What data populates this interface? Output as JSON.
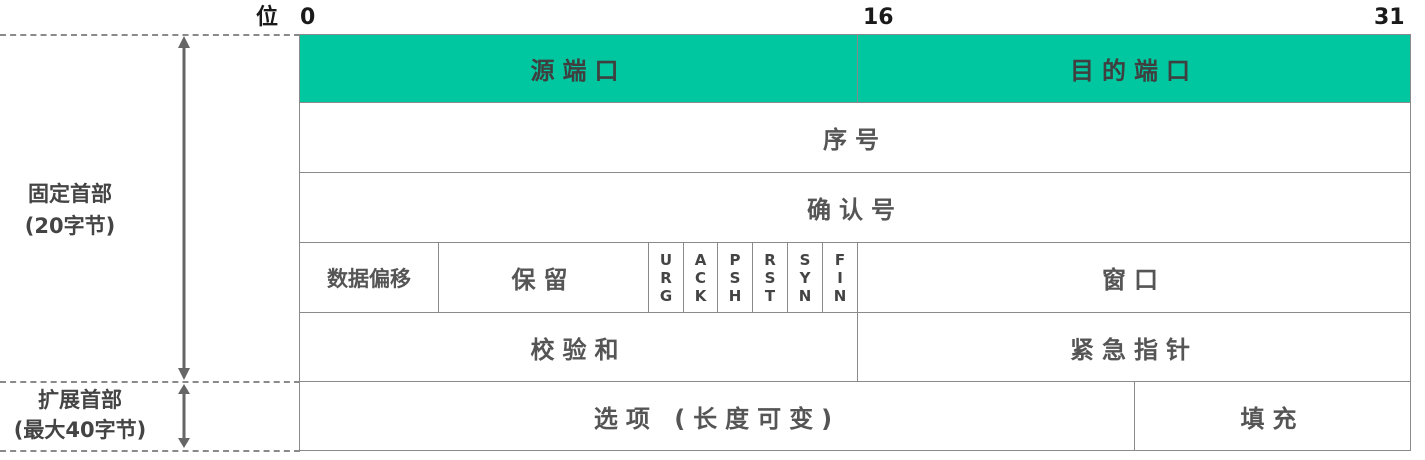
{
  "bits": {
    "unit": "位",
    "start": "0",
    "mid": "16",
    "end": "31"
  },
  "side": {
    "fixed_line1": "固定首部",
    "fixed_line2": "(20字节)",
    "ext_line1": "扩展首部",
    "ext_line2": "(最大40字节)"
  },
  "fields": {
    "src_port": "源端口",
    "dst_port": "目的端口",
    "seq": "序号",
    "ack": "确认号",
    "offset": "数据偏移",
    "reserved": "保留",
    "flags": [
      {
        "name": "URG",
        "chars": [
          "U",
          "R",
          "G"
        ]
      },
      {
        "name": "ACK",
        "chars": [
          "A",
          "C",
          "K"
        ]
      },
      {
        "name": "PSH",
        "chars": [
          "P",
          "S",
          "H"
        ]
      },
      {
        "name": "RST",
        "chars": [
          "R",
          "S",
          "T"
        ]
      },
      {
        "name": "SYN",
        "chars": [
          "S",
          "Y",
          "N"
        ]
      },
      {
        "name": "FIN",
        "chars": [
          "F",
          "I",
          "N"
        ]
      }
    ],
    "window": "窗口",
    "checksum": "校验和",
    "urgent": "紧急指针",
    "options": "选项 (长度可变)",
    "padding": "填充"
  },
  "colors": {
    "header_fill": "#00c7a0",
    "border": "#8a8a8a",
    "text": "#555555"
  }
}
